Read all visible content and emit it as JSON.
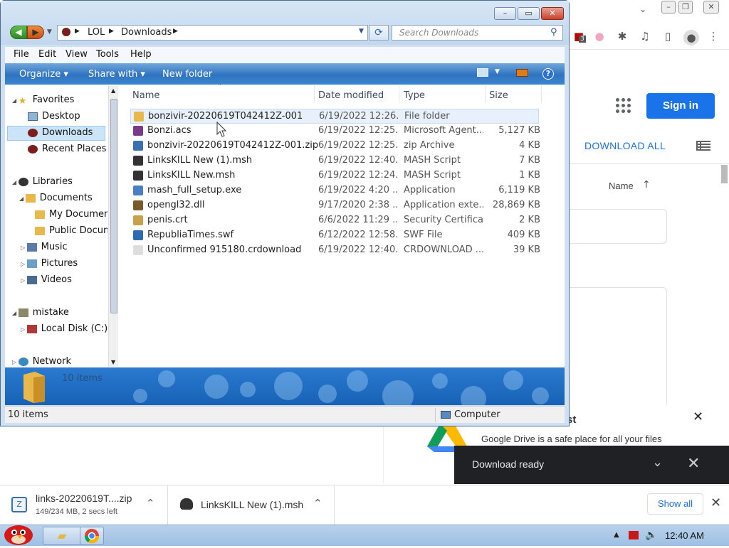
{
  "chrome": {
    "sign_in": "Sign in",
    "download_all": "DOWNLOAD ALL",
    "name_column": "Name",
    "extension_badge": "3"
  },
  "drive_card": {
    "title": "st",
    "text": "Google Drive is a safe place for all your files"
  },
  "toast": {
    "text": "Download ready"
  },
  "shelf": {
    "items": [
      {
        "name": "links-20220619T....zip",
        "sub": "149/234 MB, 2 secs left"
      },
      {
        "name": "LinksKILL New (1).msh",
        "sub": ""
      }
    ],
    "show_all": "Show all"
  },
  "taskbar": {
    "clock": "12:40 AM"
  },
  "explorer": {
    "address": {
      "segments": [
        "LOL",
        "Downloads"
      ]
    },
    "search_placeholder": "Search Downloads",
    "menu": [
      "File",
      "Edit",
      "View",
      "Tools",
      "Help"
    ],
    "commands": {
      "organize": "Organize",
      "share_with": "Share with",
      "new_folder": "New folder"
    },
    "nav": {
      "favorites": "Favorites",
      "desktop": "Desktop",
      "downloads": "Downloads",
      "recent_places": "Recent Places",
      "libraries": "Libraries",
      "documents": "Documents",
      "my_documents": "My Documents",
      "public_documents": "Public Documents",
      "music": "Music",
      "pictures": "Pictures",
      "videos": "Videos",
      "mistake": "mistake",
      "local_disk": "Local Disk (C:)",
      "network": "Network"
    },
    "columns": {
      "name": "Name",
      "date": "Date modified",
      "type": "Type",
      "size": "Size"
    },
    "files": [
      {
        "name": "bonzivir-20220619T042412Z-001",
        "date": "6/19/2022 12:26...",
        "type": "File folder",
        "size": "",
        "icon": "folder-icon",
        "color": "#e8b84a"
      },
      {
        "name": "Bonzi.acs",
        "date": "6/19/2022 12:25...",
        "type": "Microsoft Agent...",
        "size": "5,127 KB",
        "icon": "agent-icon",
        "color": "#7a3a8c"
      },
      {
        "name": "bonzivir-20220619T042412Z-001.zip",
        "date": "6/19/2022 12:25...",
        "type": "zip Archive",
        "size": "4 KB",
        "icon": "zip-icon",
        "color": "#3a6fb0"
      },
      {
        "name": "LinksKILL New (1).msh",
        "date": "6/19/2022 12:40...",
        "type": "MASH Script",
        "size": "7 KB",
        "icon": "mash-icon",
        "color": "#333333"
      },
      {
        "name": "LinksKILL New.msh",
        "date": "6/19/2022 12:24...",
        "type": "MASH Script",
        "size": "1 KB",
        "icon": "mash-icon",
        "color": "#333333"
      },
      {
        "name": "mash_full_setup.exe",
        "date": "6/19/2022 4:20 ...",
        "type": "Application",
        "size": "6,119 KB",
        "icon": "setup-icon",
        "color": "#4a7fc1"
      },
      {
        "name": "opengl32.dll",
        "date": "9/17/2020 2:38 ...",
        "type": "Application exte...",
        "size": "28,869 KB",
        "icon": "dll-icon",
        "color": "#7a5a2a"
      },
      {
        "name": "penis.crt",
        "date": "6/6/2022 11:29 ...",
        "type": "Security Certifica...",
        "size": "2 KB",
        "icon": "certificate-icon",
        "color": "#c9a14a"
      },
      {
        "name": "RepubliaTimes.swf",
        "date": "6/12/2022 12:58...",
        "type": "SWF File",
        "size": "409 KB",
        "icon": "swf-icon",
        "color": "#2b6cb0"
      },
      {
        "name": "Unconfirmed 915180.crdownload",
        "date": "6/19/2022 12:40...",
        "type": "CRDOWNLOAD ...",
        "size": "39 KB",
        "icon": "blank-file-icon",
        "color": "#dddddd"
      }
    ],
    "detail": {
      "count": "10 items"
    },
    "status": {
      "count": "10 items",
      "computer": "Computer"
    }
  }
}
